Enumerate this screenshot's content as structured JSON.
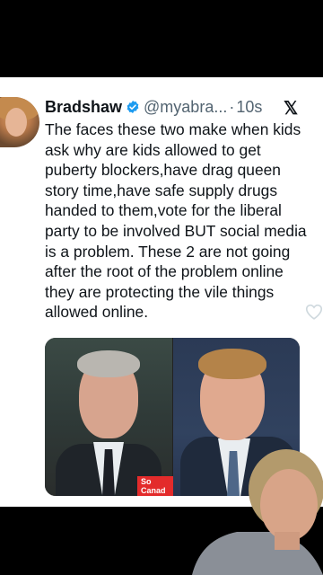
{
  "tweet": {
    "author_name": "Bradshaw",
    "handle": "@myabra...",
    "separator": "·",
    "time": "10s",
    "platform_logo": "𝕏",
    "text": "The faces these two make when kids ask why are kids allowed to get puberty blockers,have drag queen story time,have safe supply drugs handed to them,vote for the liberal party to be involved BUT social media is a problem. These 2 are not going after the root of the problem online they are protecting the vile things allowed online."
  },
  "media": {
    "badge_text": "So\nCanad"
  },
  "icons": {
    "verified": "verified-badge-icon",
    "platform": "x-logo-icon",
    "like": "heart-icon"
  },
  "colors": {
    "verified_blue": "#1d9bf0",
    "text": "#0f1419",
    "secondary": "#536471",
    "badge_red": "#e32b2b"
  }
}
